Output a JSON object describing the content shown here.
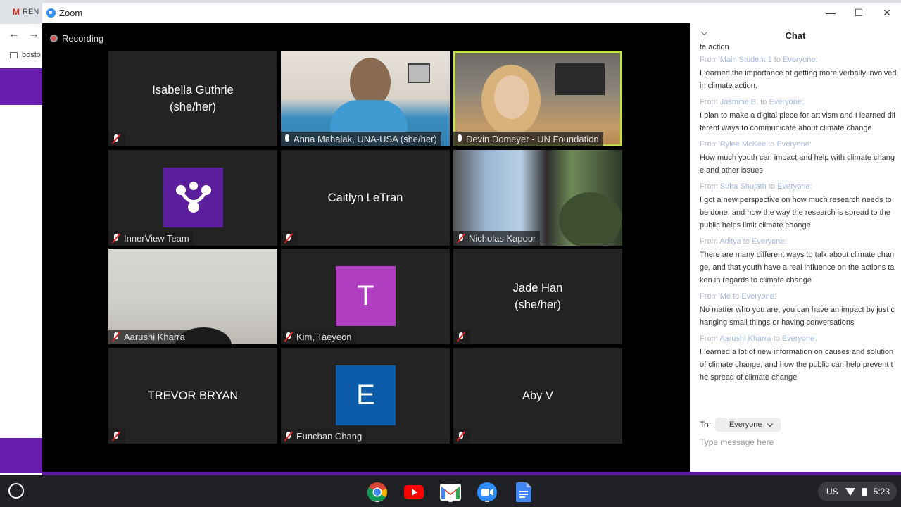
{
  "browser": {
    "tab_label": "REN",
    "bookmark_label": "bosto"
  },
  "window": {
    "app_title": "Zoom",
    "minimize": "—",
    "maximize": "☐",
    "close": "✕"
  },
  "recording": {
    "label": "Recording"
  },
  "participants": [
    {
      "name": "Isabella Guthrie (she/her)",
      "display": "Isabella Guthrie\n(she/her)",
      "muted": true,
      "video": false
    },
    {
      "name": "Anna Mahalak, UNA-USA (she/her)",
      "muted": false,
      "video": true
    },
    {
      "name": "Devin Domeyer - UN Foundation",
      "muted": false,
      "video": true,
      "active_speaker": true
    },
    {
      "name": "InnerView Team",
      "muted": true,
      "video": false,
      "avatar_color": "#5b1f9e"
    },
    {
      "name": "Caitlyn LeTran",
      "display": "Caitlyn LeTran",
      "muted": true,
      "video": false
    },
    {
      "name": "Nicholas Kapoor",
      "muted": true,
      "video": true
    },
    {
      "name": "Aarushi Kharra",
      "muted": true,
      "video": true
    },
    {
      "name": "Kim, Taeyeon",
      "muted": true,
      "video": false,
      "avatar_letter": "T",
      "avatar_color": "#b03fc0"
    },
    {
      "name": "Jade Han (she/her)",
      "display": "Jade Han\n(she/her)",
      "muted": true,
      "video": false
    },
    {
      "name": "TREVOR BRYAN",
      "display": "TREVOR BRYAN",
      "muted": true,
      "video": false
    },
    {
      "name": "Eunchan Chang",
      "muted": true,
      "video": false,
      "avatar_letter": "E",
      "avatar_color": "#0b5ba8"
    },
    {
      "name": "Aby V",
      "display": "Aby V",
      "muted": true,
      "video": false
    }
  ],
  "chat": {
    "title": "Chat",
    "partial_line": "te action",
    "messages": [
      {
        "from": "Main Student 1",
        "to": "Everyone",
        "text": "I learned the importance of getting more verbally involved in climate action."
      },
      {
        "from": "Jasmine B.",
        "to": "Everyone",
        "text": "I plan to make a digital piece for artivism and I learned different ways to communicate about climate change"
      },
      {
        "from": "Rylee McKee",
        "to": "Everyone",
        "text": "How much youth can impact and help with climate change and other issues"
      },
      {
        "from": "Suha Shujath",
        "to": "Everyone",
        "text": "I got a new perspective on how much research needs to be done, and how the way the research is spread to the public helps limit climate change"
      },
      {
        "from": "Aditya",
        "to": "Everyone",
        "text": "There are many different ways to talk about climate change, and that youth have a real influence on the actions taken in regards to climate change"
      },
      {
        "from": "Me",
        "to": "Everyone",
        "text": "No matter who you are, you can have an impact by just changing small things or having conversations"
      },
      {
        "from": "Aarushi Kharra",
        "to": "Everyone",
        "text": "I learned a lot of new information on causes and solution of climate change, and how the public can help prevent the spread of climate change"
      }
    ],
    "from_prefix": "From",
    "to_word": "to",
    "to_label": "To:",
    "recipient": "Everyone",
    "input_placeholder": "Type message here"
  },
  "taskbar": {
    "apps": [
      "chrome-icon",
      "youtube-icon",
      "gmail-icon",
      "zoom-icon",
      "docs-icon"
    ],
    "locale": "US",
    "time": "5:23"
  }
}
